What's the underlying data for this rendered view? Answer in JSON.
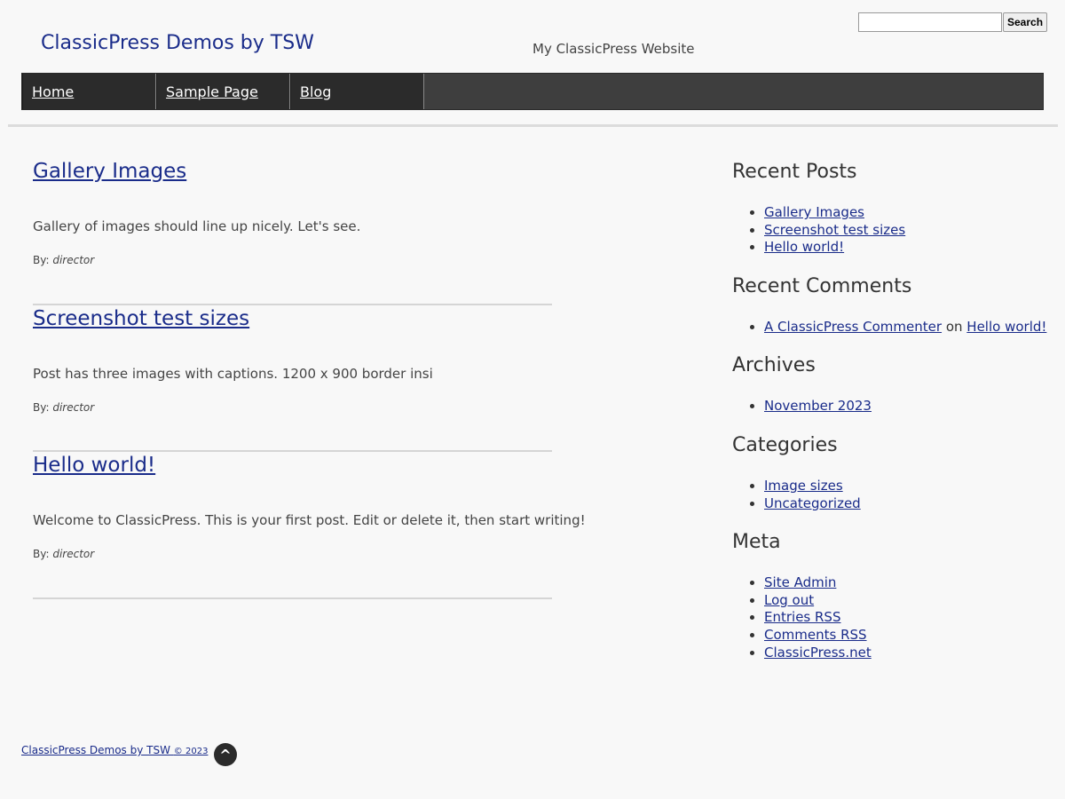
{
  "header": {
    "site_title": "ClassicPress Demos by TSW",
    "tagline": "My ClassicPress Website",
    "search": {
      "placeholder": "",
      "value": "",
      "button_label": "Search"
    }
  },
  "nav": {
    "items": [
      {
        "label": "Home"
      },
      {
        "label": "Sample Page"
      },
      {
        "label": "Blog"
      }
    ]
  },
  "posts": [
    {
      "title": "Gallery Images",
      "excerpt": "Gallery of images should line up nicely. Let's see.",
      "by_label": "By:",
      "author": "director"
    },
    {
      "title": "Screenshot test sizes",
      "excerpt": "Post has three images with captions. 1200 x 900 border insi",
      "by_label": "By:",
      "author": "director"
    },
    {
      "title": "Hello world!",
      "excerpt": "Welcome to ClassicPress. This is your first post. Edit or delete it, then start writing!",
      "by_label": "By:",
      "author": "director"
    }
  ],
  "sidebar": {
    "recent_posts": {
      "title": "Recent Posts",
      "items": [
        "Gallery Images",
        "Screenshot test sizes",
        "Hello world!"
      ]
    },
    "recent_comments": {
      "title": "Recent Comments",
      "items": [
        {
          "author": "A ClassicPress Commenter",
          "connector": "on",
          "post": "Hello world!"
        }
      ]
    },
    "archives": {
      "title": "Archives",
      "items": [
        "November 2023"
      ]
    },
    "categories": {
      "title": "Categories",
      "items": [
        "Image sizes",
        "Uncategorized"
      ]
    },
    "meta": {
      "title": "Meta",
      "items": [
        "Site Admin",
        "Log out",
        "Entries RSS",
        "Comments RSS",
        "ClassicPress.net"
      ]
    }
  },
  "footer": {
    "site_link": "ClassicPress Demos by TSW",
    "copyright": "© 2023",
    "back_to_top_icon": "^"
  },
  "colors": {
    "link": "#1a2c8a",
    "nav_bg": "#2b2b2b",
    "page_bg": "#f8f8f8"
  }
}
